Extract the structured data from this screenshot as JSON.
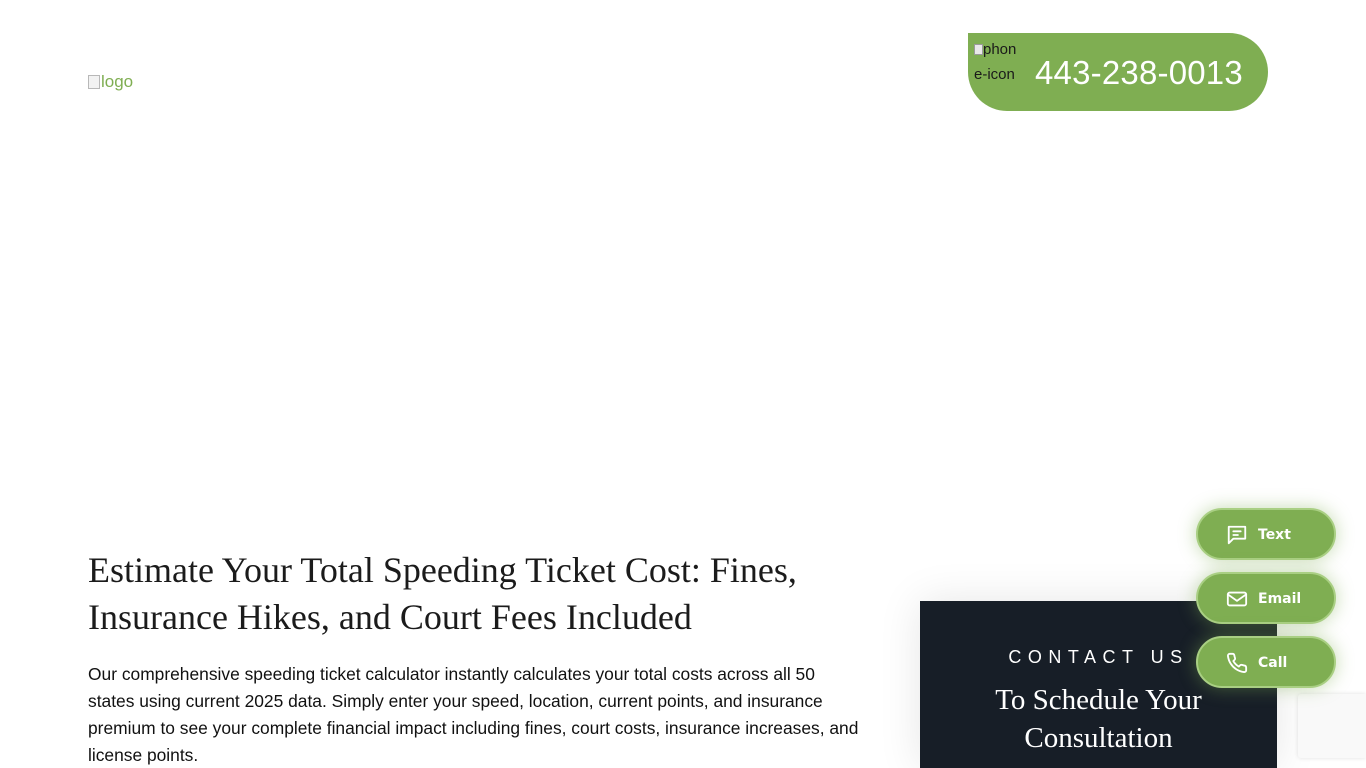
{
  "header": {
    "logo_alt": "logo",
    "phone_icon_alt": "phone-icon",
    "phone_number": "443-238-0013"
  },
  "main": {
    "heading": "Estimate Your Total Speeding Ticket Cost: Fines, Insurance Hikes, and Court Fees Included",
    "intro": "Our comprehensive speeding ticket calculator instantly calculates your total costs across all 50 states using current 2025 data. Simply enter your speed, location, current points, and insurance premium to see your complete financial impact including fines, court costs, insurance increases, and license points."
  },
  "contact_card": {
    "kicker": "CONTACT US",
    "title": "To Schedule Your Consultation"
  },
  "floating_actions": {
    "text_label": "Text",
    "email_label": "Email",
    "call_label": "Call"
  },
  "colors": {
    "accent_green": "#7fae52",
    "dark_navy": "#171e27"
  },
  "icons": {
    "text": "chat-bubble-icon",
    "email": "envelope-icon",
    "call": "phone-icon"
  }
}
